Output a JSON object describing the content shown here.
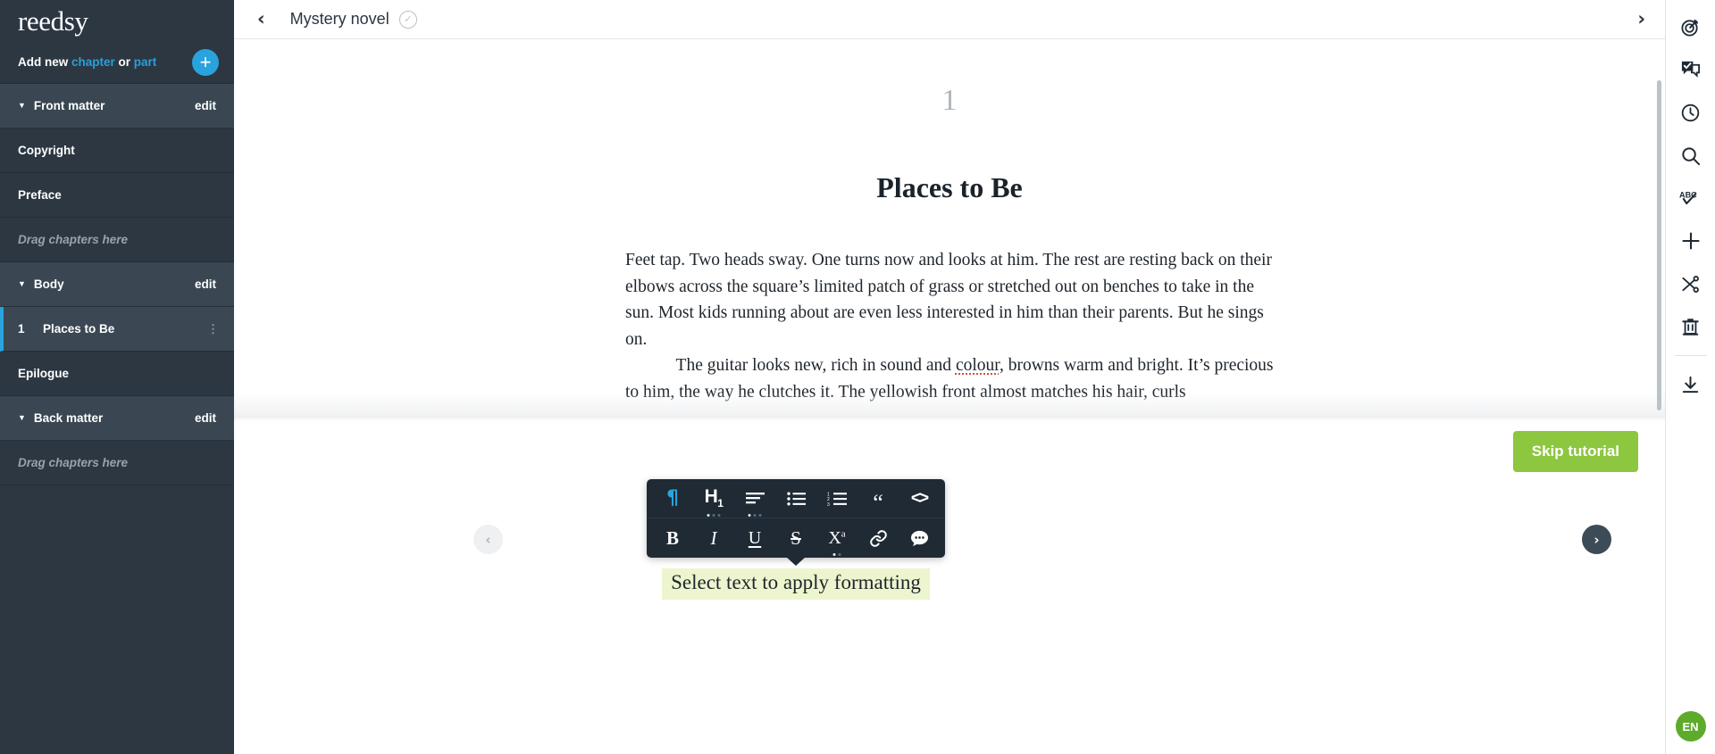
{
  "sidebar": {
    "brand": "reedsy",
    "add_new": {
      "prefix": "Add new ",
      "chapter": "chapter",
      "middle": " or ",
      "part": "part",
      "plus": "+"
    },
    "sections": [
      {
        "id": "front-matter",
        "title": "Front matter",
        "edit": "edit",
        "caret": "▼",
        "items": [
          {
            "label": "Copyright",
            "type": "chapter"
          },
          {
            "label": "Preface",
            "type": "chapter"
          }
        ],
        "dropzone": "Drag chapters here"
      },
      {
        "id": "body",
        "title": "Body",
        "edit": "edit",
        "caret": "▼",
        "items": [
          {
            "number": "1",
            "label": "Places to Be",
            "type": "chapter",
            "active": true,
            "grip": "drag-handle"
          },
          {
            "label": "Epilogue",
            "type": "chapter"
          }
        ]
      },
      {
        "id": "back-matter",
        "title": "Back matter",
        "edit": "edit",
        "caret": "▼",
        "dropzone": "Drag chapters here"
      }
    ]
  },
  "topbar": {
    "back_icon": "chevron-left",
    "title": "Mystery novel",
    "saved_icon": "check-circle",
    "forward_icon": "chevron-right"
  },
  "editor": {
    "chapter_number": "1",
    "chapter_title": "Places to Be",
    "paragraphs": [
      "Feet tap. Two heads sway. One turns now and looks at him. The rest are resting back on their elbows across the square’s limited patch of grass or stretched out on benches to take in the sun. Most kids running about are even less interested in him than their parents. But he sings on.",
      "The guitar looks new, rich in sound and colour, browns warm and bright. It’s precious to him, the way he clutches it. The yellowish front almost matches his hair, curls"
    ],
    "misspelled_word": "colour"
  },
  "toolbar": {
    "rows": [
      [
        {
          "name": "paragraph",
          "glyph": "¶",
          "active": true
        },
        {
          "name": "heading",
          "glyph": "H",
          "sub": "1",
          "dots": [
            1,
            0,
            0
          ]
        },
        {
          "name": "align",
          "glyph": "align-left-icon",
          "dots": [
            1,
            0,
            0
          ]
        },
        {
          "name": "bullet-list",
          "glyph": "bullet-list-icon"
        },
        {
          "name": "numbered-list",
          "glyph": "numbered-list-icon"
        },
        {
          "name": "blockquote",
          "glyph": "“"
        },
        {
          "name": "code-block",
          "glyph": "<>"
        }
      ],
      [
        {
          "name": "bold",
          "glyph": "B"
        },
        {
          "name": "italic",
          "glyph": "I"
        },
        {
          "name": "underline",
          "glyph": "U"
        },
        {
          "name": "strikethrough",
          "glyph": "S"
        },
        {
          "name": "superscript",
          "glyph": "X",
          "sup": "a",
          "dots": [
            1,
            0
          ]
        },
        {
          "name": "link",
          "glyph": "link-icon"
        },
        {
          "name": "comment",
          "glyph": "comment-icon"
        }
      ]
    ],
    "tooltip": "Select text to apply formatting"
  },
  "tutorial": {
    "skip_label": "Skip tutorial",
    "prev_glyph": "‹",
    "next_glyph": "›"
  },
  "rail": {
    "icons": [
      {
        "name": "goals-icon"
      },
      {
        "name": "comments-icon"
      },
      {
        "name": "history-icon"
      },
      {
        "name": "search-icon"
      },
      {
        "name": "spellcheck-icon"
      },
      {
        "name": "insert-icon"
      },
      {
        "name": "split-icon"
      },
      {
        "name": "delete-icon"
      },
      {
        "name": "export-icon"
      }
    ],
    "language": "EN"
  },
  "colors": {
    "sidebar_bg": "#2c3742",
    "sidebar_section_bg": "#3a4753",
    "accent_blue": "#29a3dd",
    "green": "#8dc63f",
    "lang_green": "#5eaa2b",
    "toolbar_bg": "#1f2a35",
    "tooltip_bg": "#edf5cf"
  }
}
